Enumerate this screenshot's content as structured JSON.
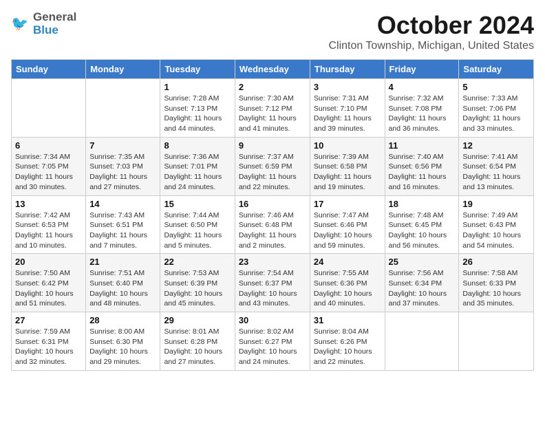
{
  "header": {
    "logo_line1": "General",
    "logo_line2": "Blue",
    "month_title": "October 2024",
    "location": "Clinton Township, Michigan, United States"
  },
  "weekdays": [
    "Sunday",
    "Monday",
    "Tuesday",
    "Wednesday",
    "Thursday",
    "Friday",
    "Saturday"
  ],
  "weeks": [
    [
      {
        "day": "",
        "sunrise": "",
        "sunset": "",
        "daylight": ""
      },
      {
        "day": "",
        "sunrise": "",
        "sunset": "",
        "daylight": ""
      },
      {
        "day": "1",
        "sunrise": "Sunrise: 7:28 AM",
        "sunset": "Sunset: 7:13 PM",
        "daylight": "Daylight: 11 hours and 44 minutes."
      },
      {
        "day": "2",
        "sunrise": "Sunrise: 7:30 AM",
        "sunset": "Sunset: 7:12 PM",
        "daylight": "Daylight: 11 hours and 41 minutes."
      },
      {
        "day": "3",
        "sunrise": "Sunrise: 7:31 AM",
        "sunset": "Sunset: 7:10 PM",
        "daylight": "Daylight: 11 hours and 39 minutes."
      },
      {
        "day": "4",
        "sunrise": "Sunrise: 7:32 AM",
        "sunset": "Sunset: 7:08 PM",
        "daylight": "Daylight: 11 hours and 36 minutes."
      },
      {
        "day": "5",
        "sunrise": "Sunrise: 7:33 AM",
        "sunset": "Sunset: 7:06 PM",
        "daylight": "Daylight: 11 hours and 33 minutes."
      }
    ],
    [
      {
        "day": "6",
        "sunrise": "Sunrise: 7:34 AM",
        "sunset": "Sunset: 7:05 PM",
        "daylight": "Daylight: 11 hours and 30 minutes."
      },
      {
        "day": "7",
        "sunrise": "Sunrise: 7:35 AM",
        "sunset": "Sunset: 7:03 PM",
        "daylight": "Daylight: 11 hours and 27 minutes."
      },
      {
        "day": "8",
        "sunrise": "Sunrise: 7:36 AM",
        "sunset": "Sunset: 7:01 PM",
        "daylight": "Daylight: 11 hours and 24 minutes."
      },
      {
        "day": "9",
        "sunrise": "Sunrise: 7:37 AM",
        "sunset": "Sunset: 6:59 PM",
        "daylight": "Daylight: 11 hours and 22 minutes."
      },
      {
        "day": "10",
        "sunrise": "Sunrise: 7:39 AM",
        "sunset": "Sunset: 6:58 PM",
        "daylight": "Daylight: 11 hours and 19 minutes."
      },
      {
        "day": "11",
        "sunrise": "Sunrise: 7:40 AM",
        "sunset": "Sunset: 6:56 PM",
        "daylight": "Daylight: 11 hours and 16 minutes."
      },
      {
        "day": "12",
        "sunrise": "Sunrise: 7:41 AM",
        "sunset": "Sunset: 6:54 PM",
        "daylight": "Daylight: 11 hours and 13 minutes."
      }
    ],
    [
      {
        "day": "13",
        "sunrise": "Sunrise: 7:42 AM",
        "sunset": "Sunset: 6:53 PM",
        "daylight": "Daylight: 11 hours and 10 minutes."
      },
      {
        "day": "14",
        "sunrise": "Sunrise: 7:43 AM",
        "sunset": "Sunset: 6:51 PM",
        "daylight": "Daylight: 11 hours and 7 minutes."
      },
      {
        "day": "15",
        "sunrise": "Sunrise: 7:44 AM",
        "sunset": "Sunset: 6:50 PM",
        "daylight": "Daylight: 11 hours and 5 minutes."
      },
      {
        "day": "16",
        "sunrise": "Sunrise: 7:46 AM",
        "sunset": "Sunset: 6:48 PM",
        "daylight": "Daylight: 11 hours and 2 minutes."
      },
      {
        "day": "17",
        "sunrise": "Sunrise: 7:47 AM",
        "sunset": "Sunset: 6:46 PM",
        "daylight": "Daylight: 10 hours and 59 minutes."
      },
      {
        "day": "18",
        "sunrise": "Sunrise: 7:48 AM",
        "sunset": "Sunset: 6:45 PM",
        "daylight": "Daylight: 10 hours and 56 minutes."
      },
      {
        "day": "19",
        "sunrise": "Sunrise: 7:49 AM",
        "sunset": "Sunset: 6:43 PM",
        "daylight": "Daylight: 10 hours and 54 minutes."
      }
    ],
    [
      {
        "day": "20",
        "sunrise": "Sunrise: 7:50 AM",
        "sunset": "Sunset: 6:42 PM",
        "daylight": "Daylight: 10 hours and 51 minutes."
      },
      {
        "day": "21",
        "sunrise": "Sunrise: 7:51 AM",
        "sunset": "Sunset: 6:40 PM",
        "daylight": "Daylight: 10 hours and 48 minutes."
      },
      {
        "day": "22",
        "sunrise": "Sunrise: 7:53 AM",
        "sunset": "Sunset: 6:39 PM",
        "daylight": "Daylight: 10 hours and 45 minutes."
      },
      {
        "day": "23",
        "sunrise": "Sunrise: 7:54 AM",
        "sunset": "Sunset: 6:37 PM",
        "daylight": "Daylight: 10 hours and 43 minutes."
      },
      {
        "day": "24",
        "sunrise": "Sunrise: 7:55 AM",
        "sunset": "Sunset: 6:36 PM",
        "daylight": "Daylight: 10 hours and 40 minutes."
      },
      {
        "day": "25",
        "sunrise": "Sunrise: 7:56 AM",
        "sunset": "Sunset: 6:34 PM",
        "daylight": "Daylight: 10 hours and 37 minutes."
      },
      {
        "day": "26",
        "sunrise": "Sunrise: 7:58 AM",
        "sunset": "Sunset: 6:33 PM",
        "daylight": "Daylight: 10 hours and 35 minutes."
      }
    ],
    [
      {
        "day": "27",
        "sunrise": "Sunrise: 7:59 AM",
        "sunset": "Sunset: 6:31 PM",
        "daylight": "Daylight: 10 hours and 32 minutes."
      },
      {
        "day": "28",
        "sunrise": "Sunrise: 8:00 AM",
        "sunset": "Sunset: 6:30 PM",
        "daylight": "Daylight: 10 hours and 29 minutes."
      },
      {
        "day": "29",
        "sunrise": "Sunrise: 8:01 AM",
        "sunset": "Sunset: 6:28 PM",
        "daylight": "Daylight: 10 hours and 27 minutes."
      },
      {
        "day": "30",
        "sunrise": "Sunrise: 8:02 AM",
        "sunset": "Sunset: 6:27 PM",
        "daylight": "Daylight: 10 hours and 24 minutes."
      },
      {
        "day": "31",
        "sunrise": "Sunrise: 8:04 AM",
        "sunset": "Sunset: 6:26 PM",
        "daylight": "Daylight: 10 hours and 22 minutes."
      },
      {
        "day": "",
        "sunrise": "",
        "sunset": "",
        "daylight": ""
      },
      {
        "day": "",
        "sunrise": "",
        "sunset": "",
        "daylight": ""
      }
    ]
  ]
}
